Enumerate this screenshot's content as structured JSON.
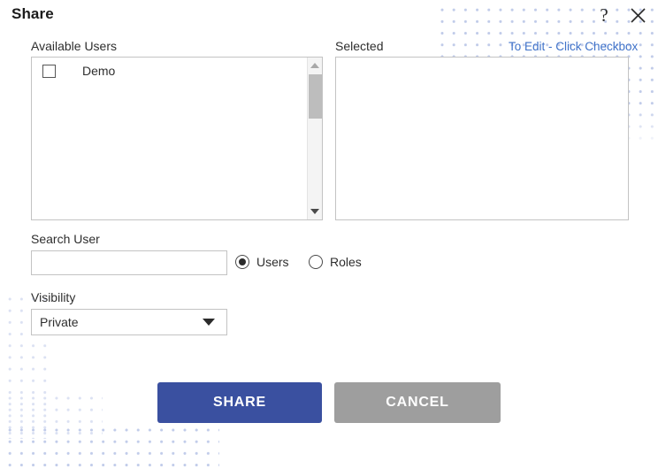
{
  "dialog": {
    "title": "Share",
    "help_icon": "question-mark-icon",
    "help_label": "?",
    "close_icon": "close-icon"
  },
  "available_users": {
    "label": "Available Users",
    "items": [
      {
        "label": "Demo",
        "checked": false
      }
    ],
    "scrollbar": {
      "up_arrow": "chevron-up-icon",
      "down_arrow": "chevron-down-icon"
    }
  },
  "selected": {
    "label": "Selected",
    "edit_hint": "To Edit - Click Checkbox",
    "items": []
  },
  "search": {
    "label": "Search User",
    "value": "",
    "placeholder": "",
    "radios": [
      {
        "label": "Users",
        "selected": true
      },
      {
        "label": "Roles",
        "selected": false
      }
    ]
  },
  "visibility": {
    "label": "Visibility",
    "value": "Private",
    "options": [
      "Private"
    ],
    "caret_icon": "chevron-down-icon"
  },
  "footer": {
    "share_label": "SHARE",
    "cancel_label": "CANCEL"
  },
  "colors": {
    "share_button": "#3a50a0",
    "cancel_button": "#9e9e9e",
    "link": "#3f72c9",
    "dot_pattern": "#8ea2d8",
    "border": "#c3c3c3"
  }
}
